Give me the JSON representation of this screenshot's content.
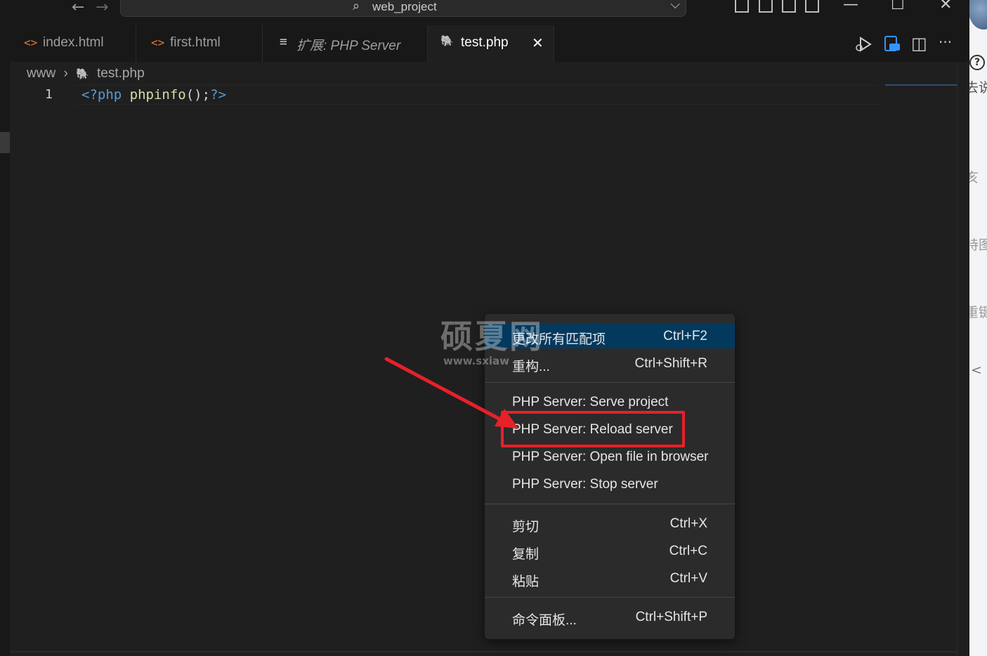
{
  "titlebar": {
    "back_icon": "←",
    "forward_icon": "→",
    "search_icon": "⌕",
    "search_label": "web_project",
    "chevron": "⌵",
    "minimize": "—",
    "maximize": "☐",
    "close": "✕"
  },
  "tabs": [
    {
      "icon": "<>",
      "icon_color": "#e37933",
      "label": "index.html"
    },
    {
      "icon": "<>",
      "icon_color": "#e37933",
      "label": "first.html"
    },
    {
      "icon": "≡",
      "icon_color": "#cccccc",
      "label": "扩展: PHP Server"
    },
    {
      "icon": "🐘",
      "icon_color": "#a074c4",
      "label": "test.php",
      "close": "✕"
    }
  ],
  "editor_actions": {
    "split": "◫",
    "more": "···"
  },
  "breadcrumb": {
    "folder": "www",
    "separator": "›",
    "file": "test.php"
  },
  "code": {
    "line_number": "1",
    "tokens": {
      "open": "<?php",
      "space": " ",
      "fn": "phpinfo",
      "punct": "();",
      "close": "?>"
    }
  },
  "context_menu": {
    "items": [
      {
        "label": "更改所有匹配项",
        "shortcut": "Ctrl+F2"
      },
      {
        "label": "重构...",
        "shortcut": "Ctrl+Shift+R"
      },
      {
        "label": "PHP Server: Serve project",
        "shortcut": ""
      },
      {
        "label": "PHP Server: Reload server",
        "shortcut": ""
      },
      {
        "label": "PHP Server: Open file in browser",
        "shortcut": ""
      },
      {
        "label": "PHP Server: Stop server",
        "shortcut": ""
      },
      {
        "label": "剪切",
        "shortcut": "Ctrl+X"
      },
      {
        "label": "复制",
        "shortcut": "Ctrl+C"
      },
      {
        "label": "粘贴",
        "shortcut": "Ctrl+V"
      },
      {
        "label": "命令面板...",
        "shortcut": "Ctrl+Shift+P"
      }
    ]
  },
  "watermark": {
    "title": "硕夏网",
    "url": "www.sxiaw"
  },
  "side_strip": {
    "help": "?",
    "texts": [
      "去说",
      "亥",
      "持图",
      "重键",
      "<"
    ]
  },
  "colors": {
    "accent": "#04395e",
    "highlight": "#e8202a",
    "background": "#1f1f1f"
  }
}
